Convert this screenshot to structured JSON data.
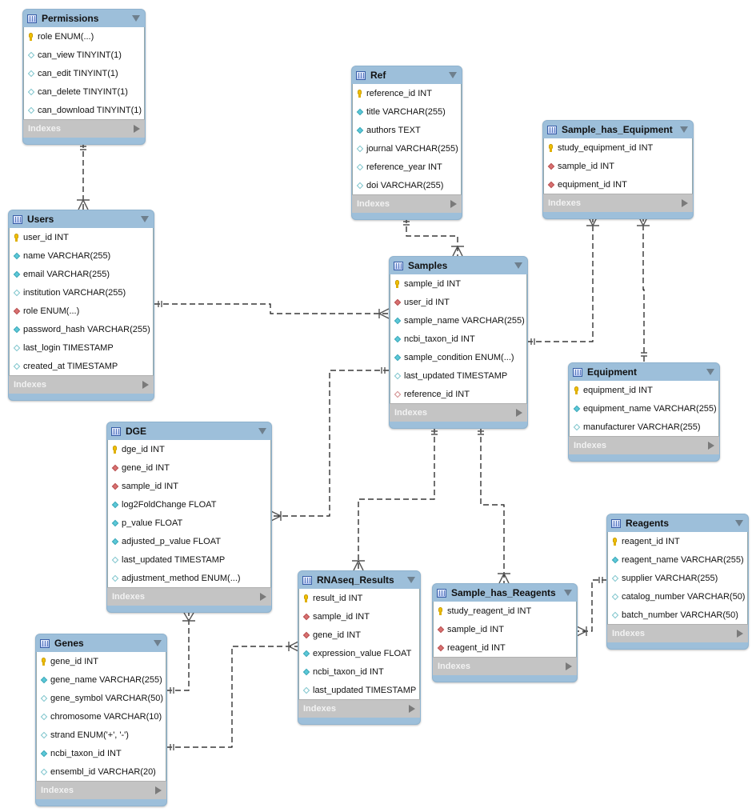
{
  "diagram": {
    "indexes_label": "Indexes",
    "tables": [
      {
        "id": "permissions",
        "name": "Permissions",
        "columns": [
          {
            "icon": "key",
            "text": "role ENUM(...)"
          },
          {
            "icon": "nl",
            "text": "can_view TINYINT(1)"
          },
          {
            "icon": "nl",
            "text": "can_edit TINYINT(1)"
          },
          {
            "icon": "nl",
            "text": "can_delete TINYINT(1)"
          },
          {
            "icon": "nl",
            "text": "can_download TINYINT(1)"
          }
        ]
      },
      {
        "id": "users",
        "name": "Users",
        "columns": [
          {
            "icon": "key",
            "text": "user_id INT"
          },
          {
            "icon": "nn",
            "text": "name VARCHAR(255)"
          },
          {
            "icon": "nn",
            "text": "email VARCHAR(255)"
          },
          {
            "icon": "nl",
            "text": "institution VARCHAR(255)"
          },
          {
            "icon": "fk",
            "text": "role ENUM(...)"
          },
          {
            "icon": "nn",
            "text": "password_hash VARCHAR(255)"
          },
          {
            "icon": "nl",
            "text": "last_login TIMESTAMP"
          },
          {
            "icon": "nl",
            "text": "created_at TIMESTAMP"
          }
        ]
      },
      {
        "id": "ref",
        "name": "Ref",
        "columns": [
          {
            "icon": "key",
            "text": "reference_id INT"
          },
          {
            "icon": "nn",
            "text": "title VARCHAR(255)"
          },
          {
            "icon": "nn",
            "text": "authors TEXT"
          },
          {
            "icon": "nl",
            "text": "journal VARCHAR(255)"
          },
          {
            "icon": "nl",
            "text": "reference_year INT"
          },
          {
            "icon": "nl",
            "text": "doi VARCHAR(255)"
          }
        ]
      },
      {
        "id": "sample_has_equipment",
        "name": "Sample_has_Equipment",
        "columns": [
          {
            "icon": "key",
            "text": "study_equipment_id INT"
          },
          {
            "icon": "fk",
            "text": "sample_id INT"
          },
          {
            "icon": "fk",
            "text": "equipment_id INT"
          }
        ]
      },
      {
        "id": "samples",
        "name": "Samples",
        "columns": [
          {
            "icon": "key",
            "text": "sample_id INT"
          },
          {
            "icon": "fk",
            "text": "user_id INT"
          },
          {
            "icon": "nn",
            "text": "sample_name VARCHAR(255)"
          },
          {
            "icon": "nn",
            "text": "ncbi_taxon_id INT"
          },
          {
            "icon": "nn",
            "text": "sample_condition ENUM(...)"
          },
          {
            "icon": "nl",
            "text": "last_updated TIMESTAMP"
          },
          {
            "icon": "fkn",
            "text": "reference_id INT"
          }
        ]
      },
      {
        "id": "equipment",
        "name": "Equipment",
        "columns": [
          {
            "icon": "key",
            "text": "equipment_id INT"
          },
          {
            "icon": "nn",
            "text": "equipment_name VARCHAR(255)"
          },
          {
            "icon": "nl",
            "text": "manufacturer VARCHAR(255)"
          }
        ]
      },
      {
        "id": "dge",
        "name": "DGE",
        "columns": [
          {
            "icon": "key",
            "text": "dge_id INT"
          },
          {
            "icon": "fk",
            "text": "gene_id INT"
          },
          {
            "icon": "fk",
            "text": "sample_id INT"
          },
          {
            "icon": "nn",
            "text": "log2FoldChange FLOAT"
          },
          {
            "icon": "nn",
            "text": "p_value FLOAT"
          },
          {
            "icon": "nn",
            "text": "adjusted_p_value FLOAT"
          },
          {
            "icon": "nl",
            "text": "last_updated TIMESTAMP"
          },
          {
            "icon": "nl",
            "text": "adjustment_method ENUM(...)"
          }
        ]
      },
      {
        "id": "reagents",
        "name": "Reagents",
        "columns": [
          {
            "icon": "key",
            "text": "reagent_id INT"
          },
          {
            "icon": "nn",
            "text": "reagent_name VARCHAR(255)"
          },
          {
            "icon": "nl",
            "text": "supplier VARCHAR(255)"
          },
          {
            "icon": "nl",
            "text": "catalog_number VARCHAR(50)"
          },
          {
            "icon": "nl",
            "text": "batch_number VARCHAR(50)"
          }
        ]
      },
      {
        "id": "rnaseq_results",
        "name": "RNAseq_Results",
        "columns": [
          {
            "icon": "key",
            "text": "result_id INT"
          },
          {
            "icon": "fk",
            "text": "sample_id INT"
          },
          {
            "icon": "fk",
            "text": "gene_id INT"
          },
          {
            "icon": "nn",
            "text": "expression_value FLOAT"
          },
          {
            "icon": "nn",
            "text": "ncbi_taxon_id INT"
          },
          {
            "icon": "nl",
            "text": "last_updated TIMESTAMP"
          }
        ]
      },
      {
        "id": "sample_has_reagents",
        "name": "Sample_has_Reagents",
        "columns": [
          {
            "icon": "key",
            "text": "study_reagent_id INT"
          },
          {
            "icon": "fk",
            "text": "sample_id INT"
          },
          {
            "icon": "fk",
            "text": "reagent_id INT"
          }
        ]
      },
      {
        "id": "genes",
        "name": "Genes",
        "columns": [
          {
            "icon": "key",
            "text": "gene_id INT"
          },
          {
            "icon": "nn",
            "text": "gene_name VARCHAR(255)"
          },
          {
            "icon": "nl",
            "text": "gene_symbol VARCHAR(50)"
          },
          {
            "icon": "nl",
            "text": "chromosome VARCHAR(10)"
          },
          {
            "icon": "nl",
            "text": "strand ENUM('+', '-')"
          },
          {
            "icon": "nn",
            "text": "ncbi_taxon_id INT"
          },
          {
            "icon": "nl",
            "text": "ensembl_id VARCHAR(20)"
          }
        ]
      }
    ],
    "relationships": [
      {
        "from": "permissions",
        "to": "users",
        "type": "one-to-many"
      },
      {
        "from": "users",
        "to": "samples",
        "type": "one-to-many"
      },
      {
        "from": "ref",
        "to": "samples",
        "type": "one-to-many"
      },
      {
        "from": "samples",
        "to": "sample_has_equipment",
        "type": "one-to-many"
      },
      {
        "from": "equipment",
        "to": "sample_has_equipment",
        "type": "one-to-many"
      },
      {
        "from": "samples",
        "to": "dge",
        "type": "one-to-many"
      },
      {
        "from": "samples",
        "to": "rnaseq_results",
        "type": "one-to-many"
      },
      {
        "from": "samples",
        "to": "sample_has_reagents",
        "type": "one-to-many"
      },
      {
        "from": "reagents",
        "to": "sample_has_reagents",
        "type": "one-to-many"
      },
      {
        "from": "genes",
        "to": "dge",
        "type": "one-to-many"
      },
      {
        "from": "genes",
        "to": "rnaseq_results",
        "type": "one-to-many"
      }
    ]
  }
}
